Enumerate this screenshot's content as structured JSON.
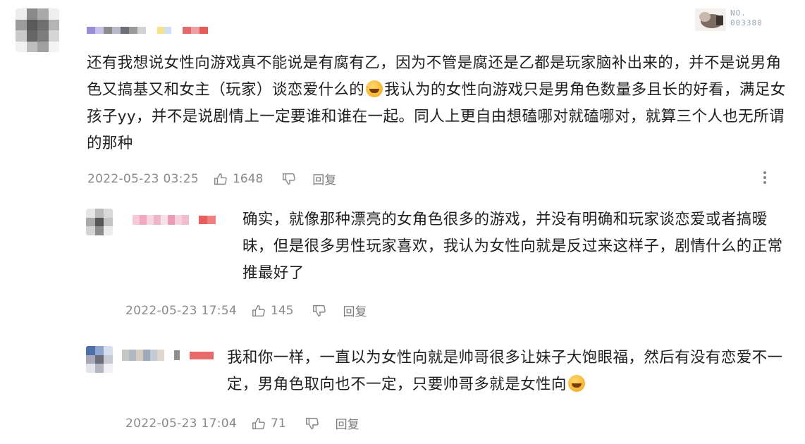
{
  "badge": {
    "line1": "NO.",
    "line2": "003380"
  },
  "comments": [
    {
      "text_a": "还有我想说女性向游戏真不能说是有腐有乙，因为不管是腐还是乙都是玩家脑补出来的，并不是说男角色又搞基又和女主（玩家）谈恋爱什么的",
      "text_b": "我认为的女性向游戏只是男角色数量多且长的好看，满足女孩子yy，并不是说剧情上一定要谁和谁在一起。同人上更自由想磕哪对就磕哪对，就算三个人也无所谓的那种",
      "time": "2022-05-23 03:25",
      "likes": "1648",
      "reply": "回复"
    },
    {
      "text": "确实，就像那种漂亮的女角色很多的游戏，并没有明确和玩家谈恋爱或者搞暧昧，但是很多男性玩家喜欢，我认为女性向就是反过来这样子，剧情什么的正常推最好了",
      "time": "2022-05-23 17:54",
      "likes": "145",
      "reply": "回复"
    },
    {
      "text": "我和你一样，一直以为女性向就是帅哥很多让妹子大饱眼福，然后有没有恋爱不一定，男角色取向也不一定，只要帅哥多就是女性向",
      "time": "2022-05-23 17:04",
      "likes": "71",
      "reply": "回复"
    }
  ],
  "icons": {
    "like": "thumbs-up-icon",
    "dislike": "thumbs-down-icon",
    "more": "more-vertical-icon",
    "emoji": "laughing-tears-emoji-icon"
  }
}
